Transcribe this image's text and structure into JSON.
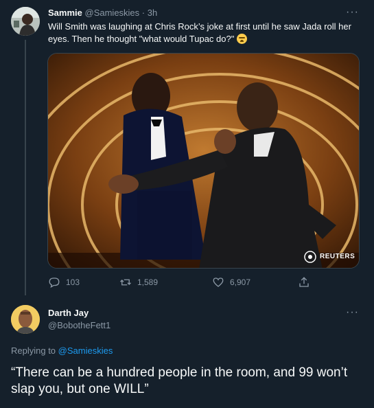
{
  "tweet": {
    "author_name": "Sammie",
    "author_handle": "@Samieskies",
    "separator": "·",
    "time": "3h",
    "more": "···",
    "text": "Will Smith was laughing at Chris Rock’s joke at first until he saw Jada roll her eyes. Then he thought \"what would Tupac do?\"",
    "emoji": "face-with-tears-emoji",
    "photo_watermark": "REUTERS",
    "actions": {
      "replies": "103",
      "retweets": "1,589",
      "likes": "6,907"
    }
  },
  "reply": {
    "author_name": "Darth Jay",
    "author_handle": "@BobotheFett1",
    "more": "···",
    "replying_prefix": "Replying to",
    "replying_to": "@Samieskies",
    "text": "“There can be a hundred people in the room, and 99 won’t slap you, but one WILL”"
  },
  "colors": {
    "background": "#15202b",
    "text": "#f7f9f9",
    "muted": "#8b98a5",
    "link": "#1d9bf0",
    "border": "#38444d"
  },
  "icons": [
    "reply-icon",
    "retweet-icon",
    "like-icon",
    "share-icon",
    "more-icon"
  ]
}
